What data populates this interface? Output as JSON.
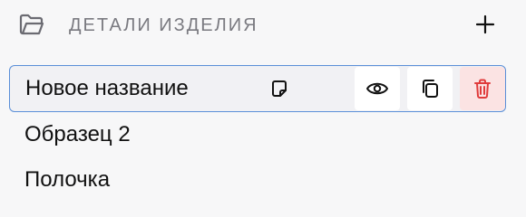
{
  "header": {
    "title": "ДЕТАЛИ ИЗДЕЛИЯ",
    "icon": "folder-open-icon",
    "add_icon": "plus-icon"
  },
  "items": [
    {
      "label": "Новое название",
      "selected": true
    },
    {
      "label": "Образец 2",
      "selected": false
    },
    {
      "label": "Полочка",
      "selected": false
    }
  ],
  "item_actions": {
    "note_icon": "note-icon",
    "view_icon": "eye-icon",
    "copy_icon": "copy-icon",
    "delete_icon": "trash-icon"
  },
  "colors": {
    "selected_border": "#5a8fd8",
    "delete_bg": "#fbe3e3",
    "delete_icon": "#e03b3b",
    "header_text": "#7a7a80"
  }
}
